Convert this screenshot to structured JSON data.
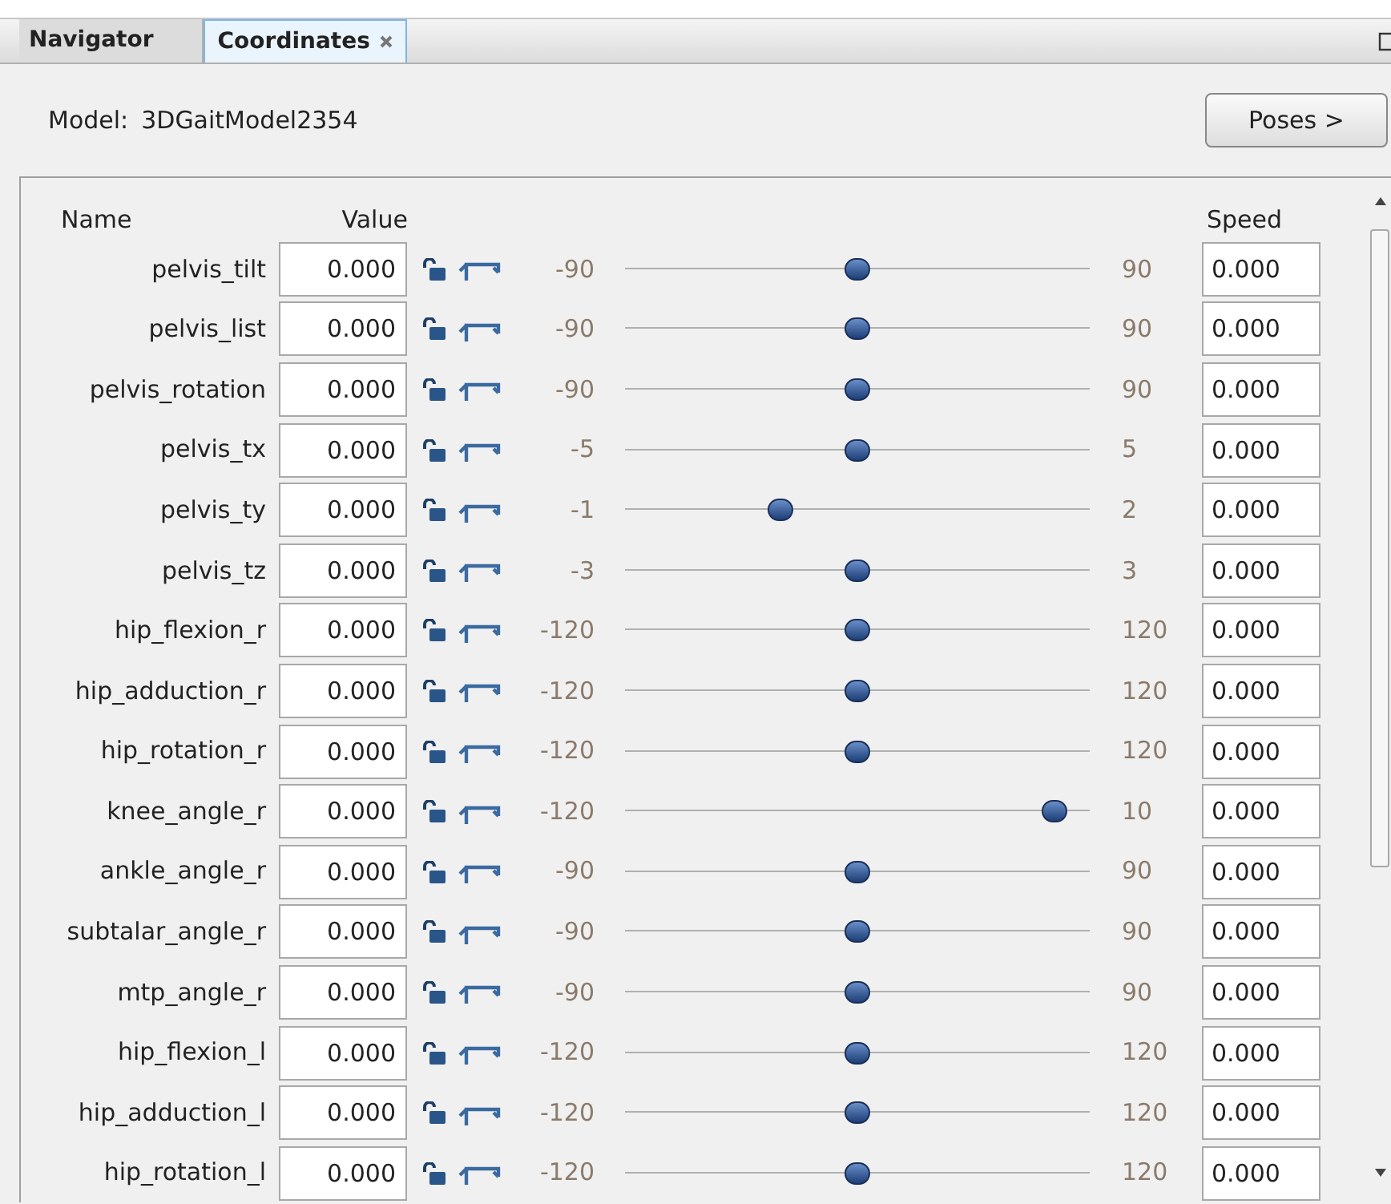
{
  "tabs": [
    {
      "label": "Navigator",
      "selected": false,
      "closable": false
    },
    {
      "label": "Coordinates",
      "selected": true,
      "closable": true
    }
  ],
  "model": {
    "label": "Model:",
    "name": "3DGaitModel2354"
  },
  "poses_button": "Poses >",
  "columns": {
    "name": "Name",
    "value": "Value",
    "speed": "Speed"
  },
  "coordinates": [
    {
      "name": "pelvis_tilt",
      "value": "0.000",
      "min": "-90",
      "max": "90",
      "level": 0.5,
      "speed": "0.000"
    },
    {
      "name": "pelvis_list",
      "value": "0.000",
      "min": "-90",
      "max": "90",
      "level": 0.5,
      "speed": "0.000"
    },
    {
      "name": "pelvis_rotation",
      "value": "0.000",
      "min": "-90",
      "max": "90",
      "level": 0.5,
      "speed": "0.000"
    },
    {
      "name": "pelvis_tx",
      "value": "0.000",
      "min": "-5",
      "max": "5",
      "level": 0.5,
      "speed": "0.000"
    },
    {
      "name": "pelvis_ty",
      "value": "0.000",
      "min": "-1",
      "max": "2",
      "level": 0.333,
      "speed": "0.000"
    },
    {
      "name": "pelvis_tz",
      "value": "0.000",
      "min": "-3",
      "max": "3",
      "level": 0.5,
      "speed": "0.000"
    },
    {
      "name": "hip_flexion_r",
      "value": "0.000",
      "min": "-120",
      "max": "120",
      "level": 0.5,
      "speed": "0.000"
    },
    {
      "name": "hip_adduction_r",
      "value": "0.000",
      "min": "-120",
      "max": "120",
      "level": 0.5,
      "speed": "0.000"
    },
    {
      "name": "hip_rotation_r",
      "value": "0.000",
      "min": "-120",
      "max": "120",
      "level": 0.5,
      "speed": "0.000"
    },
    {
      "name": "knee_angle_r",
      "value": "0.000",
      "min": "-120",
      "max": "10",
      "level": 0.923,
      "speed": "0.000"
    },
    {
      "name": "ankle_angle_r",
      "value": "0.000",
      "min": "-90",
      "max": "90",
      "level": 0.5,
      "speed": "0.000"
    },
    {
      "name": "subtalar_angle_r",
      "value": "0.000",
      "min": "-90",
      "max": "90",
      "level": 0.5,
      "speed": "0.000"
    },
    {
      "name": "mtp_angle_r",
      "value": "0.000",
      "min": "-90",
      "max": "90",
      "level": 0.5,
      "speed": "0.000"
    },
    {
      "name": "hip_flexion_l",
      "value": "0.000",
      "min": "-120",
      "max": "120",
      "level": 0.5,
      "speed": "0.000"
    },
    {
      "name": "hip_adduction_l",
      "value": "0.000",
      "min": "-120",
      "max": "120",
      "level": 0.5,
      "speed": "0.000"
    },
    {
      "name": "hip_rotation_l",
      "value": "0.000",
      "min": "-120",
      "max": "120",
      "level": 0.5,
      "speed": "0.000"
    }
  ]
}
